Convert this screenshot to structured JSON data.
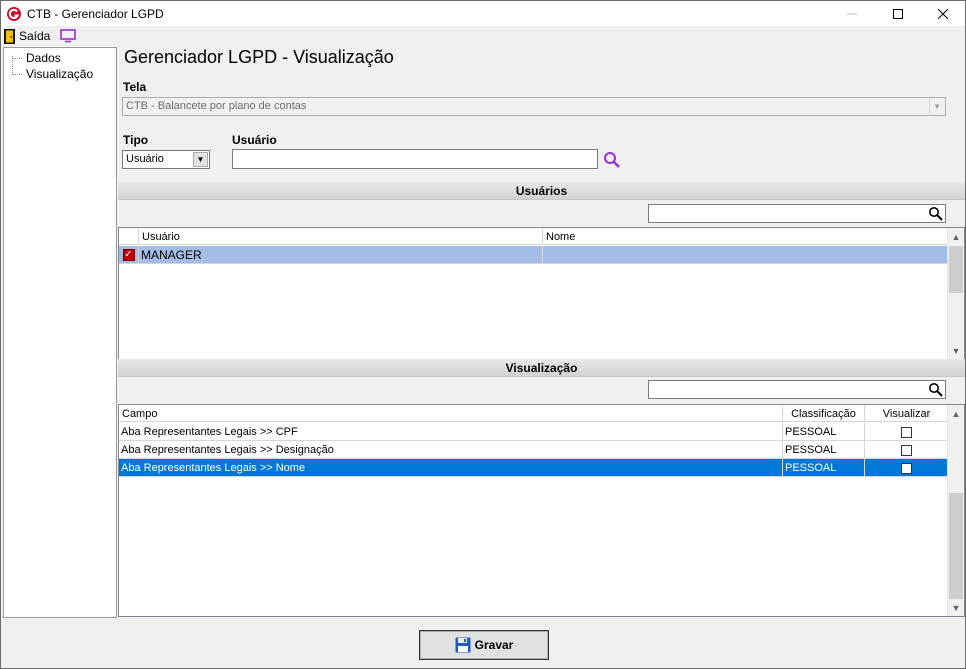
{
  "window": {
    "title": "CTB - Gerenciador LGPD",
    "app_icon": "app-logo-icon"
  },
  "menubar": {
    "exit_label": "Saída",
    "exit_icon": "exit-door-icon",
    "second_icon": "monitor-icon"
  },
  "tree": {
    "items": [
      {
        "label": "Dados"
      },
      {
        "label": "Visualização"
      }
    ]
  },
  "page": {
    "title": "Gerenciador LGPD - Visualização"
  },
  "form": {
    "tela_label": "Tela",
    "tela_value": "CTB - Balancete por plano de contas",
    "tipo_label": "Tipo",
    "tipo_value": "Usuário",
    "usuario_label": "Usuário",
    "usuario_value": ""
  },
  "usuarios_section": {
    "title": "Usuários",
    "search_value": "",
    "columns": [
      "Usuário",
      "Nome"
    ],
    "rows": [
      {
        "checked": true,
        "usuario": "MANAGER",
        "nome": ""
      }
    ]
  },
  "visualizacao_section": {
    "title": "Visualização",
    "search_value": "",
    "columns": [
      "Campo",
      "Classificação",
      "Visualizar"
    ],
    "rows": [
      {
        "campo": "Aba Representantes Legais >> CPF",
        "classificacao": "PESSOAL",
        "visualizar": false
      },
      {
        "campo": "Aba Representantes Legais >> Designação",
        "classificacao": "PESSOAL",
        "visualizar": false
      },
      {
        "campo": "Aba Representantes Legais >> Nome",
        "classificacao": "PESSOAL",
        "visualizar": false
      }
    ]
  },
  "footer": {
    "save_label": "Gravar",
    "save_icon": "floppy-disk-icon"
  },
  "colors": {
    "selected_light": "#a4bde8",
    "selected_blue": "#0078d7",
    "accent_purple": "#9a2fd0",
    "check_red": "#c00000"
  }
}
